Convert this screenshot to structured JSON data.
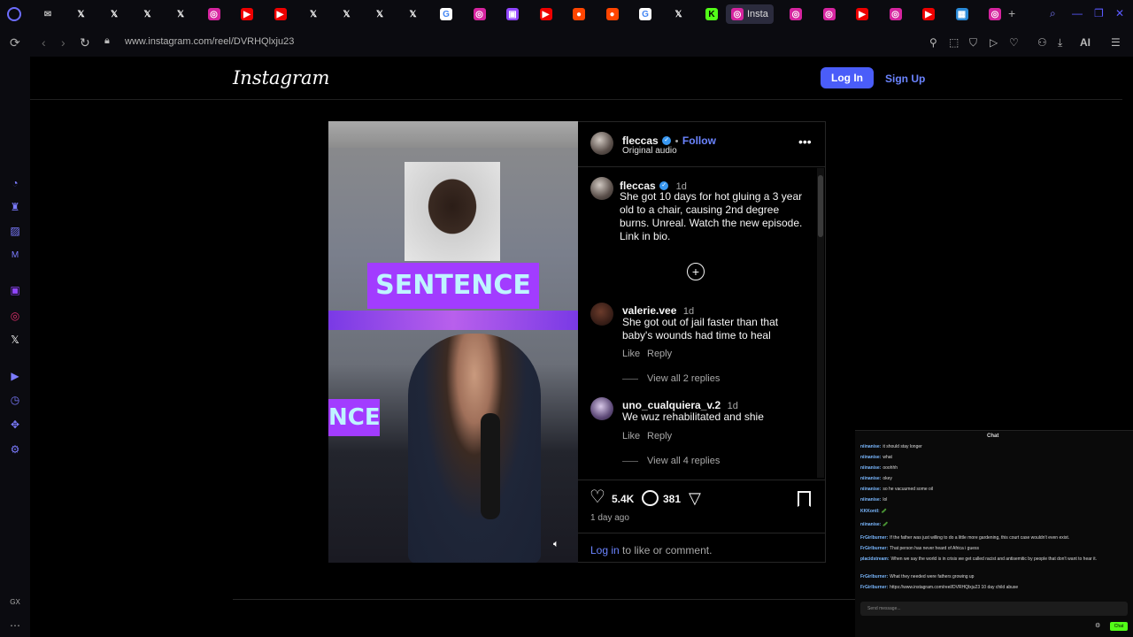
{
  "browser": {
    "url": "www.instagram.com/reel/DVRHQlxju23",
    "active_tab_label": "Insta",
    "ai_label": "AI",
    "sidebar_bottom_label": "GX",
    "tab_icons": [
      "mail-icon",
      "x-icon",
      "x-icon",
      "x-icon",
      "x-icon",
      "instagram-icon",
      "youtube-music-icon",
      "youtube-music-icon",
      "x-icon",
      "x-icon",
      "x-icon",
      "x-icon",
      "google-icon",
      "instagram-icon",
      "twitch-icon",
      "youtube-icon",
      "reddit-icon",
      "reddit-icon",
      "google-icon",
      "x-icon",
      "kick-icon",
      "instagram-icon",
      "instagram-icon",
      "instagram-icon",
      "youtube-icon",
      "instagram-icon",
      "youtube-icon",
      "app-icon",
      "instagram-icon"
    ]
  },
  "instagram": {
    "logo": "Instagram",
    "login_label": "Log In",
    "signup_label": "Sign Up"
  },
  "reel": {
    "overlay_text": "SENTENCE",
    "overlay_text_partial": "NCE",
    "author": "fleccas",
    "follow_label": "Follow",
    "dot": "•",
    "audio": "Original audio",
    "caption": {
      "user": "fleccas",
      "time": "1d",
      "text": "She got 10 days for hot gluing a 3 year old to a chair, causing 2nd degree burns. Unreal. Watch the new episode. Link in bio."
    },
    "comments": [
      {
        "user": "valerie.vee",
        "time": "1d",
        "text": "She got out of jail faster than that baby's wounds had time to heal",
        "like": "Like",
        "reply": "Reply",
        "view_replies": "View all 2 replies"
      },
      {
        "user": "uno_cualquiera_v.2",
        "time": "1d",
        "text": "We wuz rehabilitated and shie",
        "like": "Like",
        "reply": "Reply",
        "view_replies": "View all 4 replies"
      }
    ],
    "likes": "5.4K",
    "comments_count": "381",
    "posted": "1 day ago",
    "login_prompt_link": "Log in",
    "login_prompt_rest": " to like or comment."
  },
  "chat": {
    "title": "Chat",
    "placeholder": "Send message...",
    "send_label": "Chat",
    "lines": [
      {
        "user": "niinanise:",
        "text": "it should stay longer"
      },
      {
        "user": "niinanise:",
        "text": "what"
      },
      {
        "user": "niinanise:",
        "text": "ooohhh"
      },
      {
        "user": "niinanise:",
        "text": "okey"
      },
      {
        "user": "niinanise:",
        "text": "so he vacuumed some oil"
      },
      {
        "user": "niinanise:",
        "text": "lol"
      },
      {
        "user": "KKKontl:",
        "text": "🥒"
      },
      {
        "user": "niinanise:",
        "text": "🥒"
      },
      {
        "user": "FrGirlburner:",
        "text": "If the father was just willing to do a little more gardening, this court case wouldn't even exist."
      },
      {
        "user": "FrGirlburner:",
        "text": "That person has never heard of Africa i guess"
      },
      {
        "user": "placidstream:",
        "text": "When we say the world is in crisis we get called racist and antisemitic by people that don't want to hear it."
      },
      {
        "user": "FrGirlburner:",
        "text": "What they needed were fathers growing up"
      },
      {
        "user": "FrGirlburner:",
        "text": "https://www.instagram.com/reel/DVRHQlxju23 10 day child abuse"
      }
    ]
  }
}
